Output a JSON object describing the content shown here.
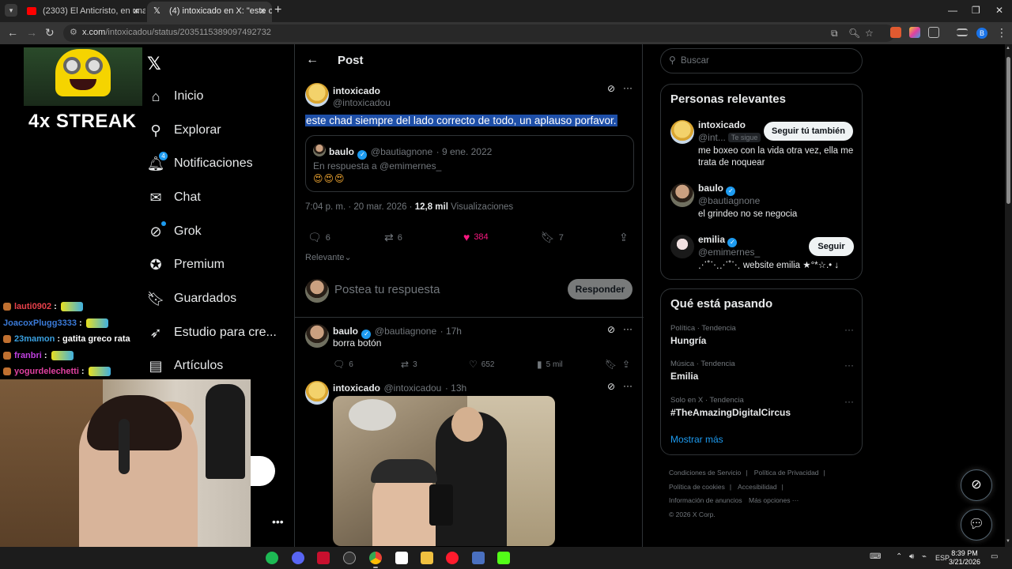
{
  "browser": {
    "tabs": [
      {
        "title": "(2303) El Anticristo, en una línea",
        "favicon": "youtube-icon"
      },
      {
        "title": "(4) intoxicado en X: \"este chad",
        "favicon": "x-icon"
      }
    ],
    "url_domain": "x.com",
    "url_path": "/intoxicadou/status/2035115389097492732"
  },
  "overlay": {
    "streak_text": "4x STREAK",
    "chat": [
      {
        "user": "lauti0902",
        "color": "#e8404a",
        "msg": ""
      },
      {
        "user": "JoacoxPlugg3333",
        "color": "#3a7ad8",
        "msg": ""
      },
      {
        "user": "23mamon",
        "color": "#3aa0e0",
        "msg": "gatita greco rata"
      },
      {
        "user": "franbri",
        "color": "#c040e0",
        "msg": ""
      },
      {
        "user": "yogurdelechetti",
        "color": "#e040a0",
        "msg": ""
      }
    ]
  },
  "nav": {
    "items": [
      {
        "label": "Inicio",
        "icon": "home-icon"
      },
      {
        "label": "Explorar",
        "icon": "search-icon"
      },
      {
        "label": "Notificaciones",
        "icon": "bell-icon",
        "badge": "4"
      },
      {
        "label": "Chat",
        "icon": "mail-icon"
      },
      {
        "label": "Grok",
        "icon": "grok-icon"
      },
      {
        "label": "Premium",
        "icon": "premium-icon"
      },
      {
        "label": "Guardados",
        "icon": "bookmark-icon"
      },
      {
        "label": "Estudio para cre...",
        "icon": "rocket-icon"
      },
      {
        "label": "Artículos",
        "icon": "article-icon"
      }
    ]
  },
  "post": {
    "header_title": "Post",
    "author_name": "intoxicado",
    "author_handle": "@intoxicadou",
    "text": "este chad siempre del lado correcto de todo, un aplauso porfavor.",
    "quote": {
      "name": "baulo",
      "handle": "@bautiagnone",
      "date": "· 9 ene. 2022",
      "reply_to": "En respuesta a @emimernes_",
      "emojis": "😍😍😍"
    },
    "time": "7:04 p. m. · 20 mar. 2026 ·",
    "views_count": "12,8 mil",
    "views_label": "Visualizaciones",
    "replies": "6",
    "reposts": "6",
    "likes": "384",
    "bookmarks": "7",
    "sort_label": "Relevante",
    "reply_placeholder": "Postea tu respuesta",
    "reply_button": "Responder"
  },
  "replies": [
    {
      "name": "baulo",
      "handle": "@bautiagnone",
      "time": "· 17h",
      "text": "borra botón",
      "replies": "6",
      "reposts": "3",
      "likes": "652",
      "views": "5 mil"
    },
    {
      "name": "intoxicado",
      "handle": "@intoxicadou",
      "time": "· 13h"
    }
  ],
  "sidebar": {
    "search_placeholder": "Buscar",
    "relevant_title": "Personas relevantes",
    "people": [
      {
        "name": "intoxicado",
        "handle": "@int...",
        "tag": "Te sigue",
        "button": "Seguir tú también",
        "bio": "me boxeo con la vida otra vez, ella me trata de noquear"
      },
      {
        "name": "baulo",
        "handle": "@bautiagnone",
        "bio": "el grindeo no se negocia"
      },
      {
        "name": "emilia",
        "handle": "@emimernes_",
        "button": "Seguir",
        "bio": "⋰˚⋱⋰˚⋱ website emilia ★°*☆.• ↓"
      }
    ],
    "trends_title": "Qué está pasando",
    "trends": [
      {
        "category": "Política · Tendencia",
        "topic": "Hungría"
      },
      {
        "category": "Música · Tendencia",
        "topic": "Emilia"
      },
      {
        "category": "Solo en X · Tendencia",
        "topic": "#TheAmazingDigitalCircus"
      }
    ],
    "show_more": "Mostrar más",
    "footer": [
      "Condiciones de Servicio",
      "|",
      "Política de Privacidad",
      "|",
      "Política de cookies",
      "|",
      "Accesibilidad",
      "|",
      "Información de anuncios",
      "Más opciones ···",
      "© 2026 X Corp."
    ]
  },
  "taskbar": {
    "lang": "ESP",
    "time": "8:39 PM",
    "date": "3/21/2026"
  }
}
